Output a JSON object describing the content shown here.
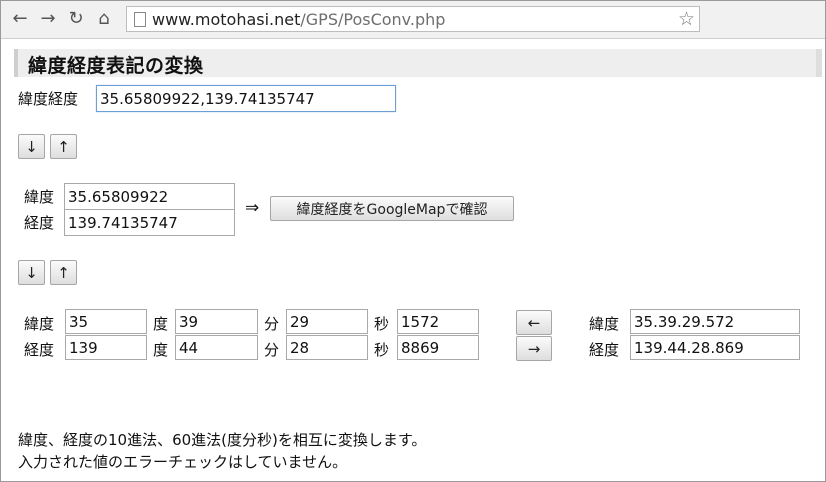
{
  "browser": {
    "nav": {
      "back": "←",
      "forward": "→",
      "reload": "↻",
      "home": "⌂"
    },
    "url_host": "www.motohasi.net",
    "url_path": "/GPS/PosConv.php",
    "star": "☆"
  },
  "page": {
    "title": "緯度経度表記の変換",
    "combined": {
      "label": "緯度経度",
      "value": "35.65809922,139.74135747"
    },
    "btn_down": "↓",
    "btn_up": "↑",
    "decimal": {
      "lat_label": "緯度",
      "lat_value": "35.65809922",
      "lng_label": "経度",
      "lng_value": "139.74135747",
      "arrow": "⇒",
      "map_button": "緯度経度をGoogleMapで確認"
    },
    "dms": {
      "lat_label": "緯度",
      "lat_deg": "35",
      "deg_unit": "度",
      "lat_min": "39",
      "min_unit": "分",
      "lat_sec": "29",
      "sec_unit": "秒",
      "lat_frac": "1572",
      "lng_label": "経度",
      "lng_deg": "139",
      "lng_min": "44",
      "lng_sec": "28",
      "lng_frac": "8869",
      "left_arrow": "←",
      "right_arrow": "→",
      "lat_dotted": "35.39.29.572",
      "lng_dotted": "139.44.28.869"
    },
    "description": [
      "緯度、経度の10進法、60進法(度分秒)を相互に変換します。",
      "入力された値のエラーチェックはしていません。"
    ]
  }
}
